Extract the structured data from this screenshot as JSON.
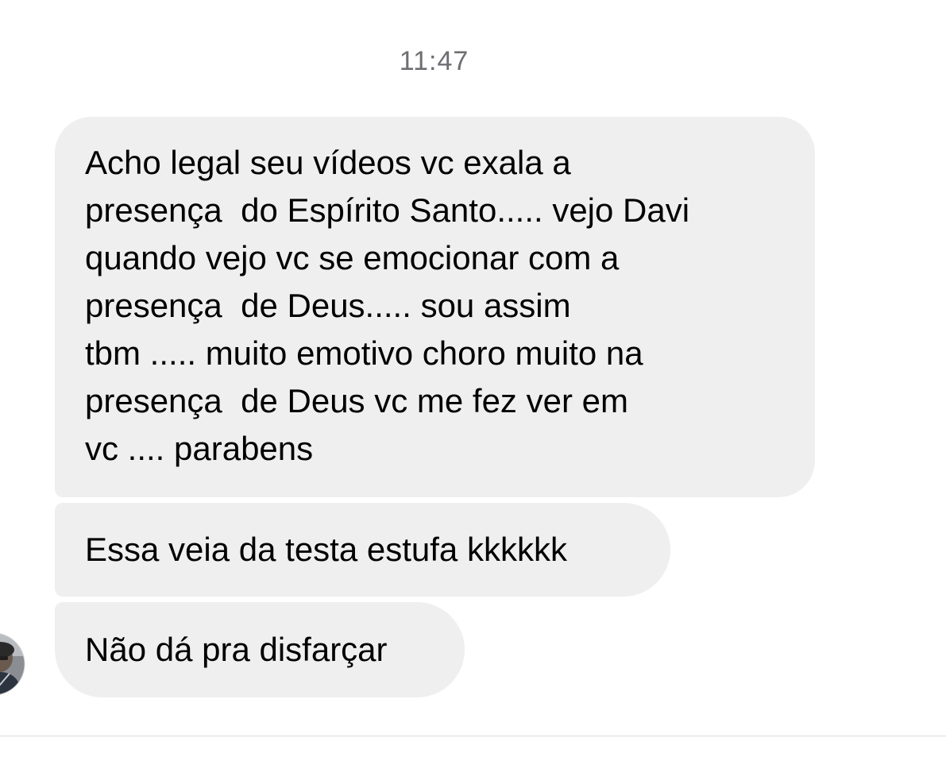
{
  "conversation": {
    "timestamp": "11:47",
    "messages": [
      {
        "lines": [
          "Acho legal seu vídeos vc exala a",
          "presença  do Espírito Santo..... vejo Davi",
          "quando vejo vc se emocionar com a",
          "presença  de Deus..... sou assim",
          "tbm ..... muito emotivo choro muito na",
          "presença  de Deus vc me fez ver em",
          "vc .... parabens"
        ]
      },
      {
        "text": "Essa veia da testa estufa kkkkkk"
      },
      {
        "text": "Não dá pra disfarçar"
      }
    ]
  },
  "colors": {
    "bubble_background": "#efefef",
    "timestamp_text": "#6e6e73",
    "message_text": "#000000",
    "page_background": "#ffffff"
  },
  "icons": {
    "sender_avatar": "avatar-photo"
  }
}
